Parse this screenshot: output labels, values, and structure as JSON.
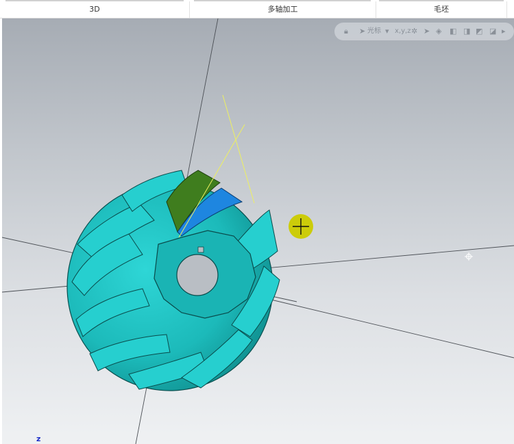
{
  "tabs": [
    {
      "label": "3D"
    },
    {
      "label": "多轴加工"
    },
    {
      "label": "毛坯"
    }
  ],
  "view_toolbar": {
    "cursor_label": "光标",
    "xyz_label": "x,y,z"
  },
  "axis_label": "z",
  "colors": {
    "part": "#1fc4c4",
    "part_shadow": "#0e8c8c",
    "selected_face_green": "#3f7d1e",
    "selected_face_blue": "#1e86e0",
    "cursor_marker": "#cccc0a",
    "guide_line": "#f0f060",
    "axis_line": "#4a4e54"
  },
  "icons": [
    "lock-icon",
    "cursor-icon",
    "pointer-icon",
    "view-icon"
  ]
}
